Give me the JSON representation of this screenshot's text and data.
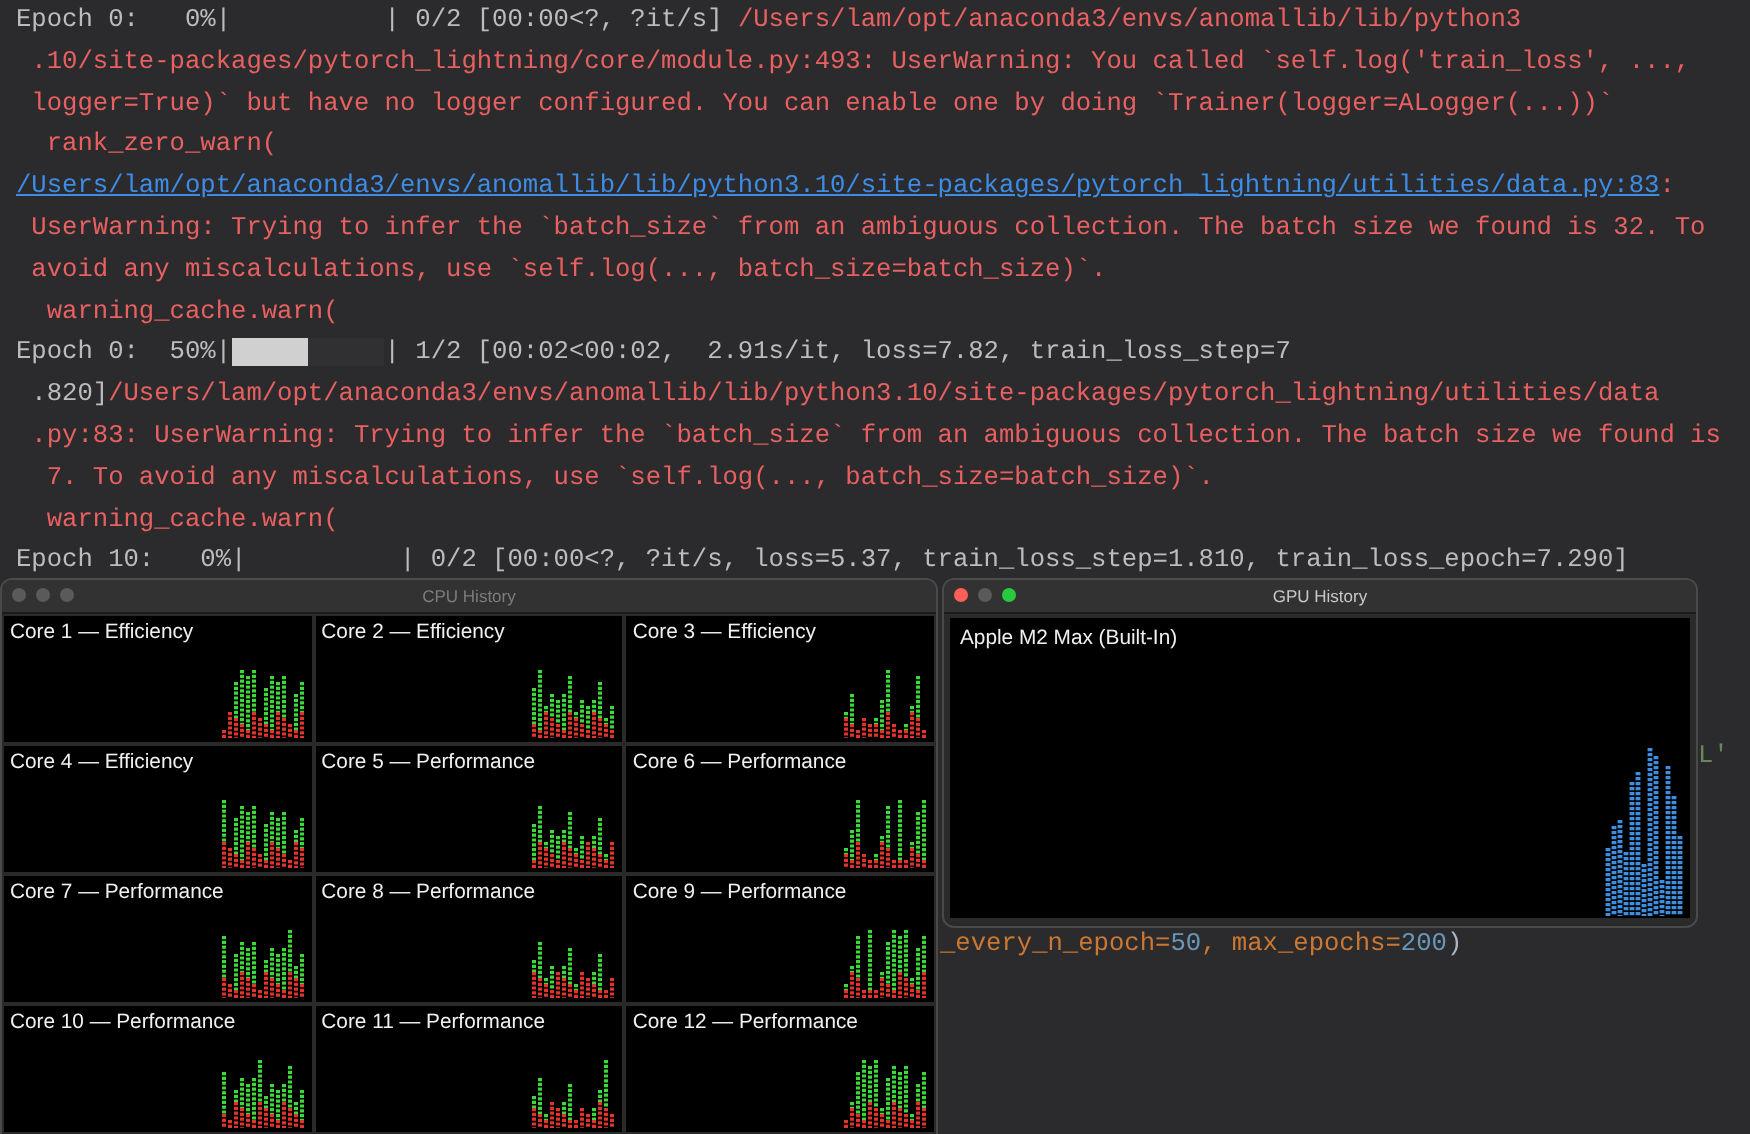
{
  "terminal": {
    "lines": [
      {
        "segments": [
          {
            "kind": "plain",
            "text": "Epoch 0:   0%|          | 0/2 [00:00<?, ?it/s] "
          },
          {
            "kind": "warning",
            "text": "/Users/lam/opt/anaconda3/envs/anomallib/lib/python3"
          }
        ]
      },
      {
        "segments": [
          {
            "kind": "warning",
            "text": " .10/site-packages/pytorch_lightning/core/module.py:493: UserWarning: You called `self.log('train_loss', ...,"
          }
        ]
      },
      {
        "segments": [
          {
            "kind": "warning",
            "text": " logger=True)` but have no logger configured. You can enable one by doing `Trainer(logger=ALogger(...))`"
          }
        ]
      },
      {
        "segments": [
          {
            "kind": "warning",
            "text": "  rank_zero_warn("
          }
        ]
      },
      {
        "segments": [
          {
            "kind": "link",
            "text": "/Users/lam/opt/anaconda3/envs/anomallib/lib/python3.10/site-packages/pytorch_lightning/utilities/data.py:83"
          },
          {
            "kind": "warning",
            "text": ":"
          }
        ]
      },
      {
        "segments": [
          {
            "kind": "warning",
            "text": " UserWarning: Trying to infer the `batch_size` from an ambiguous collection. The batch size we found is 32. To"
          }
        ]
      },
      {
        "segments": [
          {
            "kind": "warning",
            "text": " avoid any miscalculations, use `self.log(..., batch_size=batch_size)`."
          }
        ]
      },
      {
        "segments": [
          {
            "kind": "warning",
            "text": "  warning_cache.warn("
          }
        ]
      },
      {
        "segments": [
          {
            "kind": "plain",
            "text": "Epoch 0:  50%|"
          },
          {
            "kind": "bar",
            "level": 0.5
          },
          {
            "kind": "plain",
            "text": "| 1/2 [00:02<00:02,  2.91s/it, loss=7.82, train_loss_step=7"
          }
        ]
      },
      {
        "segments": [
          {
            "kind": "plain",
            "text": " .820]"
          },
          {
            "kind": "warning",
            "text": "/Users/lam/opt/anaconda3/envs/anomallib/lib/python3.10/site-packages/pytorch_lightning/utilities/data"
          }
        ]
      },
      {
        "segments": [
          {
            "kind": "warning",
            "text": " .py:83: UserWarning: Trying to infer the `batch_size` from an ambiguous collection. The batch size we found is"
          }
        ]
      },
      {
        "segments": [
          {
            "kind": "warning",
            "text": "  7. To avoid any miscalculations, use `self.log(..., batch_size=batch_size)`."
          }
        ]
      },
      {
        "segments": [
          {
            "kind": "warning",
            "text": "  warning_cache.warn("
          }
        ]
      },
      {
        "segments": [
          {
            "kind": "plain",
            "text": "Epoch 10:   0%|          | 0/2 [00:00<?, ?it/s, loss=5.37, train_loss_step=1.810, train_loss_epoch=7.290]"
          }
        ]
      }
    ]
  },
  "editor": {
    "fragment": "L'",
    "code": [
      {
        "kind": "name",
        "text": "_every_n_epoch="
      },
      {
        "kind": "number",
        "text": "50"
      },
      {
        "kind": "name",
        "text": ", max_epochs="
      },
      {
        "kind": "number",
        "text": "200"
      },
      {
        "kind": "punct",
        "text": ")"
      }
    ]
  },
  "cpu_window": {
    "title": "CPU History",
    "active": false,
    "cores": [
      {
        "label": "Core 1 — Efficiency"
      },
      {
        "label": "Core 2 — Efficiency"
      },
      {
        "label": "Core 3 — Efficiency"
      },
      {
        "label": "Core 4 — Efficiency"
      },
      {
        "label": "Core 5 — Performance"
      },
      {
        "label": "Core 6 — Performance"
      },
      {
        "label": "Core 7 — Performance"
      },
      {
        "label": "Core 8 — Performance"
      },
      {
        "label": "Core 9 — Performance"
      },
      {
        "label": "Core 10 — Performance"
      },
      {
        "label": "Core 11 — Performance"
      },
      {
        "label": "Core 12 — Performance"
      }
    ]
  },
  "gpu_window": {
    "title": "GPU History",
    "active": true,
    "device": "Apple M2 Max (Built-In)"
  }
}
